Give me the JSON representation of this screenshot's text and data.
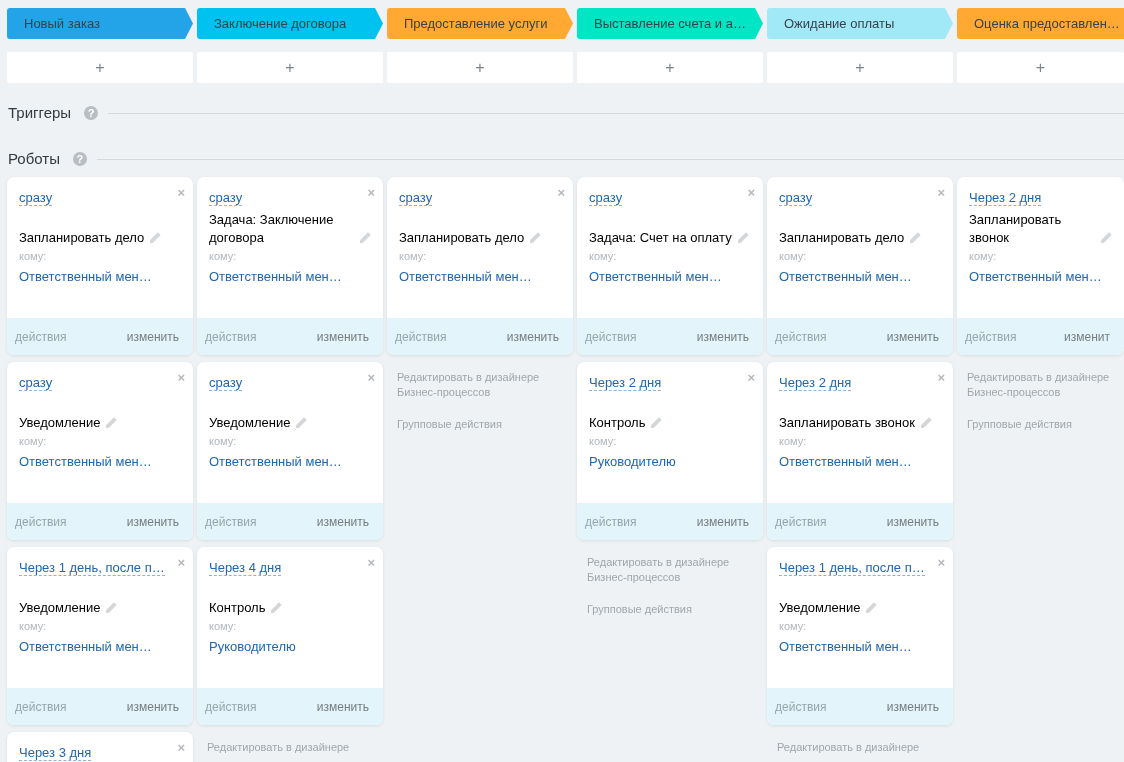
{
  "stages": [
    {
      "title": "Новый заказ",
      "color": "#24a4e8",
      "add": "+"
    },
    {
      "title": "Заключение договора",
      "color": "#00c2f0",
      "add": "+"
    },
    {
      "title": "Предоставление услуги",
      "color": "#ffa932",
      "add": "+"
    },
    {
      "title": "Выставление счета и а…",
      "color": "#00e5c3",
      "add": "+"
    },
    {
      "title": "Ожидание оплаты",
      "color": "#a2e9f8",
      "add": "+"
    },
    {
      "title": "Оценка предоставлен…",
      "color": "#ffa932",
      "add": "+"
    }
  ],
  "triggers": {
    "title": "Триггеры",
    "help": "?"
  },
  "robots": {
    "title": "Роботы",
    "help": "?",
    "columns": [
      {
        "cards": [
          {
            "trigger": "сразу",
            "close": "×",
            "title": "Запланировать дело",
            "to_label": "кому:",
            "recipient": "Ответственный мен…",
            "actions": "действия",
            "actions_disabled": true,
            "edit": "изменить"
          },
          {
            "trigger": "сразу",
            "close": "×",
            "title": "Уведомление",
            "to_label": "кому:",
            "recipient": "Ответственный мен…",
            "actions": "действия",
            "actions_disabled": true,
            "edit": "изменить"
          },
          {
            "trigger": "Через 1 день, после п…",
            "close": "×",
            "title": "Уведомление",
            "to_label": "кому:",
            "recipient": "Ответственный мен…",
            "actions": "действия",
            "actions_disabled": true,
            "edit": "изменить"
          },
          {
            "trigger": "Через 3 дня",
            "close": "×"
          }
        ]
      },
      {
        "cards": [
          {
            "trigger": "сразу",
            "close": "×",
            "title": "Задача: Заключение договора",
            "to_label": "кому:",
            "recipient": "Ответственный мен…",
            "actions": "действия",
            "actions_disabled": true,
            "edit": "изменить"
          },
          {
            "trigger": "сразу",
            "close": "×",
            "title": "Уведомление",
            "to_label": "кому:",
            "recipient": "Ответственный мен…",
            "actions": "действия",
            "actions_disabled": true,
            "edit": "изменить"
          },
          {
            "trigger": "Через 4 дня",
            "close": "×",
            "title": "Контроль",
            "to_label": "кому:",
            "recipient": "Руководителю",
            "actions": "действия",
            "actions_disabled": true,
            "edit": "изменить"
          }
        ],
        "links": [
          {
            "kind": "designer",
            "text": "Редактировать в дизайнере"
          }
        ]
      },
      {
        "cards": [
          {
            "trigger": "сразу",
            "close": "×",
            "title": "Запланировать дело",
            "to_label": "кому:",
            "recipient": "Ответственный мен…",
            "actions": "действия",
            "actions_disabled": true,
            "edit": "изменить"
          }
        ],
        "links": [
          {
            "kind": "designer",
            "text": "Редактировать в дизайнере Бизнес-процессов"
          },
          {
            "kind": "group",
            "text": "Групповые действия"
          }
        ]
      },
      {
        "cards": [
          {
            "trigger": "сразу",
            "close": "×",
            "title": "Задача: Счет на оплату",
            "to_label": "кому:",
            "recipient": "Ответственный мен…",
            "actions": "действия",
            "actions_disabled": true,
            "edit": "изменить"
          },
          {
            "trigger": "Через 2 дня",
            "close": "×",
            "title": "Контроль",
            "to_label": "кому:",
            "recipient": "Руководителю",
            "actions": "действия",
            "actions_disabled": true,
            "edit": "изменить"
          }
        ],
        "links": [
          {
            "kind": "designer",
            "text": "Редактировать в дизайнере Бизнес-процессов"
          },
          {
            "kind": "group",
            "text": "Групповые действия"
          }
        ]
      },
      {
        "cards": [
          {
            "trigger": "сразу",
            "close": "×",
            "title": "Запланировать дело",
            "to_label": "кому:",
            "recipient": "Ответственный мен…",
            "actions": "действия",
            "actions_disabled": true,
            "edit": "изменить"
          },
          {
            "trigger": "Через 2 дня",
            "close": "×",
            "title": "Запланировать звонок",
            "to_label": "кому:",
            "recipient": "Ответственный мен…",
            "actions": "действия",
            "actions_disabled": true,
            "edit": "изменить"
          },
          {
            "trigger": "Через 1 день, после п…",
            "close": "×",
            "title": "Уведомление",
            "to_label": "кому:",
            "recipient": "Ответственный мен…",
            "actions": "действия",
            "actions_disabled": true,
            "edit": "изменить"
          }
        ],
        "links": [
          {
            "kind": "designer",
            "text": "Редактировать в дизайнере"
          }
        ]
      },
      {
        "cards": [
          {
            "trigger": "Через 2 дня",
            "title": "Запланировать звонок",
            "to_label": "кому:",
            "recipient": "Ответственный мен…",
            "actions": "действия",
            "actions_disabled": true,
            "edit": "изменит"
          }
        ],
        "links": [
          {
            "kind": "designer",
            "text": "Редактировать в дизайнере Бизнес-процессов"
          },
          {
            "kind": "group",
            "text": "Групповые действия"
          }
        ]
      }
    ]
  }
}
